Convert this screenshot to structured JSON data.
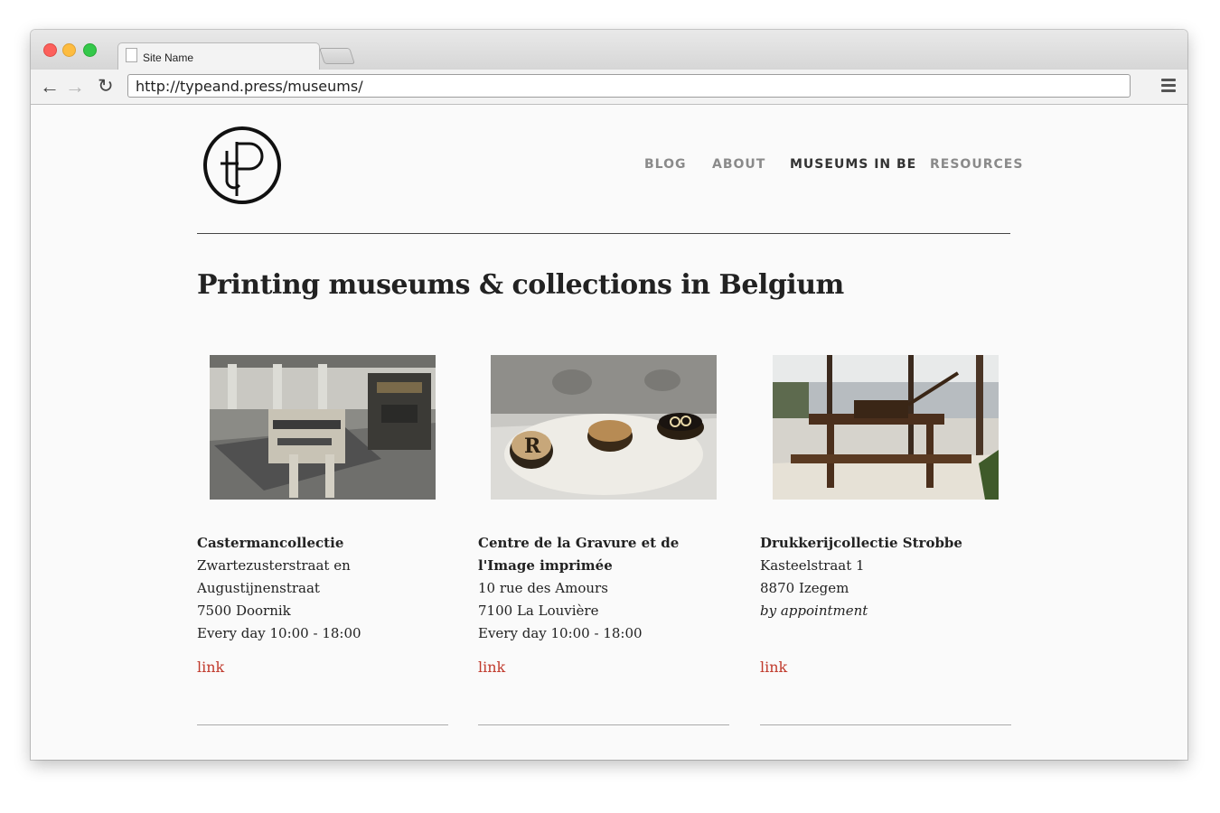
{
  "browser": {
    "tab_title": "Site Name",
    "url": "http://typeand.press/museums/"
  },
  "site": {
    "logo_text": "tP",
    "nav": [
      {
        "label": "BLOG",
        "active": false
      },
      {
        "label": "ABOUT",
        "active": false
      },
      {
        "label": "MUSEUMS IN BE",
        "active": true
      },
      {
        "label": "RESOURCES",
        "active": false
      }
    ],
    "heading": "Printing museums & collections in Belgium"
  },
  "museums": [
    {
      "name": "Castermancollectie",
      "address_lines": [
        "Zwartezusterstraat en",
        "Augustijnenstraat",
        "7500 Doornik"
      ],
      "hours": "Every day 10:00 - 18:00",
      "link": "link"
    },
    {
      "name": "Centre de la Gravure et de l'Image imprimée",
      "address_lines": [
        "10 rue des Amours",
        "7100 La Louvière"
      ],
      "hours": "Every day 10:00 - 18:00",
      "link": "link"
    },
    {
      "name": "Drukkerijcollectie Strobbe",
      "address_lines": [
        "Kasteelstraat 1",
        "8870 Izegem"
      ],
      "hours": "by appointment",
      "link": "link"
    }
  ],
  "colors": {
    "link": "#c0392b",
    "nav_inactive": "#8a8a8a",
    "nav_active": "#333333"
  }
}
